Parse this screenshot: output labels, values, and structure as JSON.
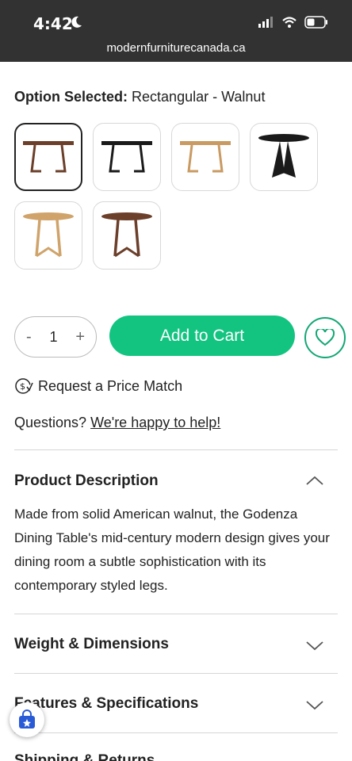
{
  "status": {
    "time": "4:42",
    "url": "modernfurniturecanada.ca"
  },
  "option": {
    "label": "Option Selected:",
    "value": "Rectangular - Walnut"
  },
  "swatches": [
    {
      "name": "Rectangular - Walnut",
      "color": "#6b3f2a",
      "shape": "rect",
      "selected": true
    },
    {
      "name": "Rectangular - Black",
      "color": "#1a1a1a",
      "shape": "rect",
      "selected": false
    },
    {
      "name": "Rectangular - Oak",
      "color": "#c99a62",
      "shape": "rect",
      "selected": false
    },
    {
      "name": "Round - Black",
      "color": "#1a1a1a",
      "shape": "round",
      "selected": false
    },
    {
      "name": "Round - Oak",
      "color": "#cfa36a",
      "shape": "round",
      "selected": false
    },
    {
      "name": "Round - Walnut",
      "color": "#6b3f2a",
      "shape": "round",
      "selected": false
    }
  ],
  "quantity": {
    "minus": "-",
    "value": "1",
    "plus": "+"
  },
  "add_to_cart": "Add to Cart",
  "price_match": "Request a Price Match",
  "questions": {
    "text": "Questions?",
    "link": "We're happy to help!"
  },
  "accordion": {
    "description_title": "Product Description",
    "description_text": "Made from solid American walnut, the Godenza Dining Table's mid-century modern design gives your dining room a subtle sophistication with its contemporary styled legs.",
    "weight_title": "Weight & Dimensions",
    "features_title": "Features & Specifications",
    "shipping_title": "Shipping & Returns"
  },
  "colors": {
    "accent": "#13c481",
    "statusbar": "#323232"
  }
}
